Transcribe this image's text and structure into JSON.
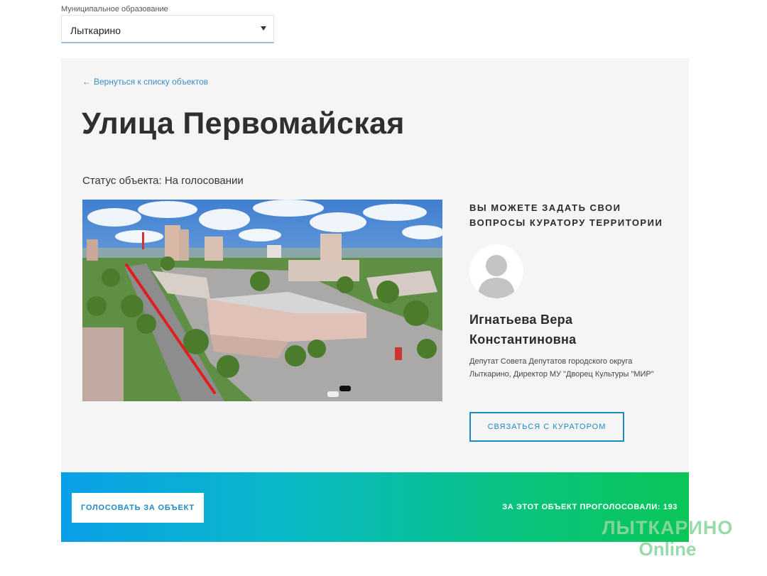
{
  "municipality": {
    "label": "Муниципальное образование",
    "selected": "Лыткарино"
  },
  "object": {
    "back_arrow": "←",
    "back_link": "Вернуться к списку объектов",
    "title": "Улица Первомайская",
    "status": "Статус объекта: На голосовании"
  },
  "curator": {
    "heading": "ВЫ МОЖЕТЕ ЗАДАТЬ СВОИ ВОПРОСЫ КУРАТОРУ ТЕРРИТОРИИ",
    "name": "Игнатьева Вера Константиновна",
    "description": "Депутат Совета Депутатов городского округа Лыткарино, Директор МУ \"Дворец Культуры \"МИР\"",
    "contact_button": "СВЯЗАТЬСЯ С КУРАТОРОМ"
  },
  "vote": {
    "button": "ГОЛОСОВАТЬ ЗА ОБЪЕКТ",
    "count_text": "ЗА ЭТОТ ОБЪЕКТ ПРОГОЛОСОВАЛИ: 193"
  },
  "watermark": {
    "line1": "ЛЫТКАРИНО",
    "line2": "Online"
  },
  "colors": {
    "accent": "#1f8ac0",
    "card_bg": "#f5f5f5",
    "gradient_start": "#0aa0e8",
    "gradient_end": "#0ac658"
  }
}
